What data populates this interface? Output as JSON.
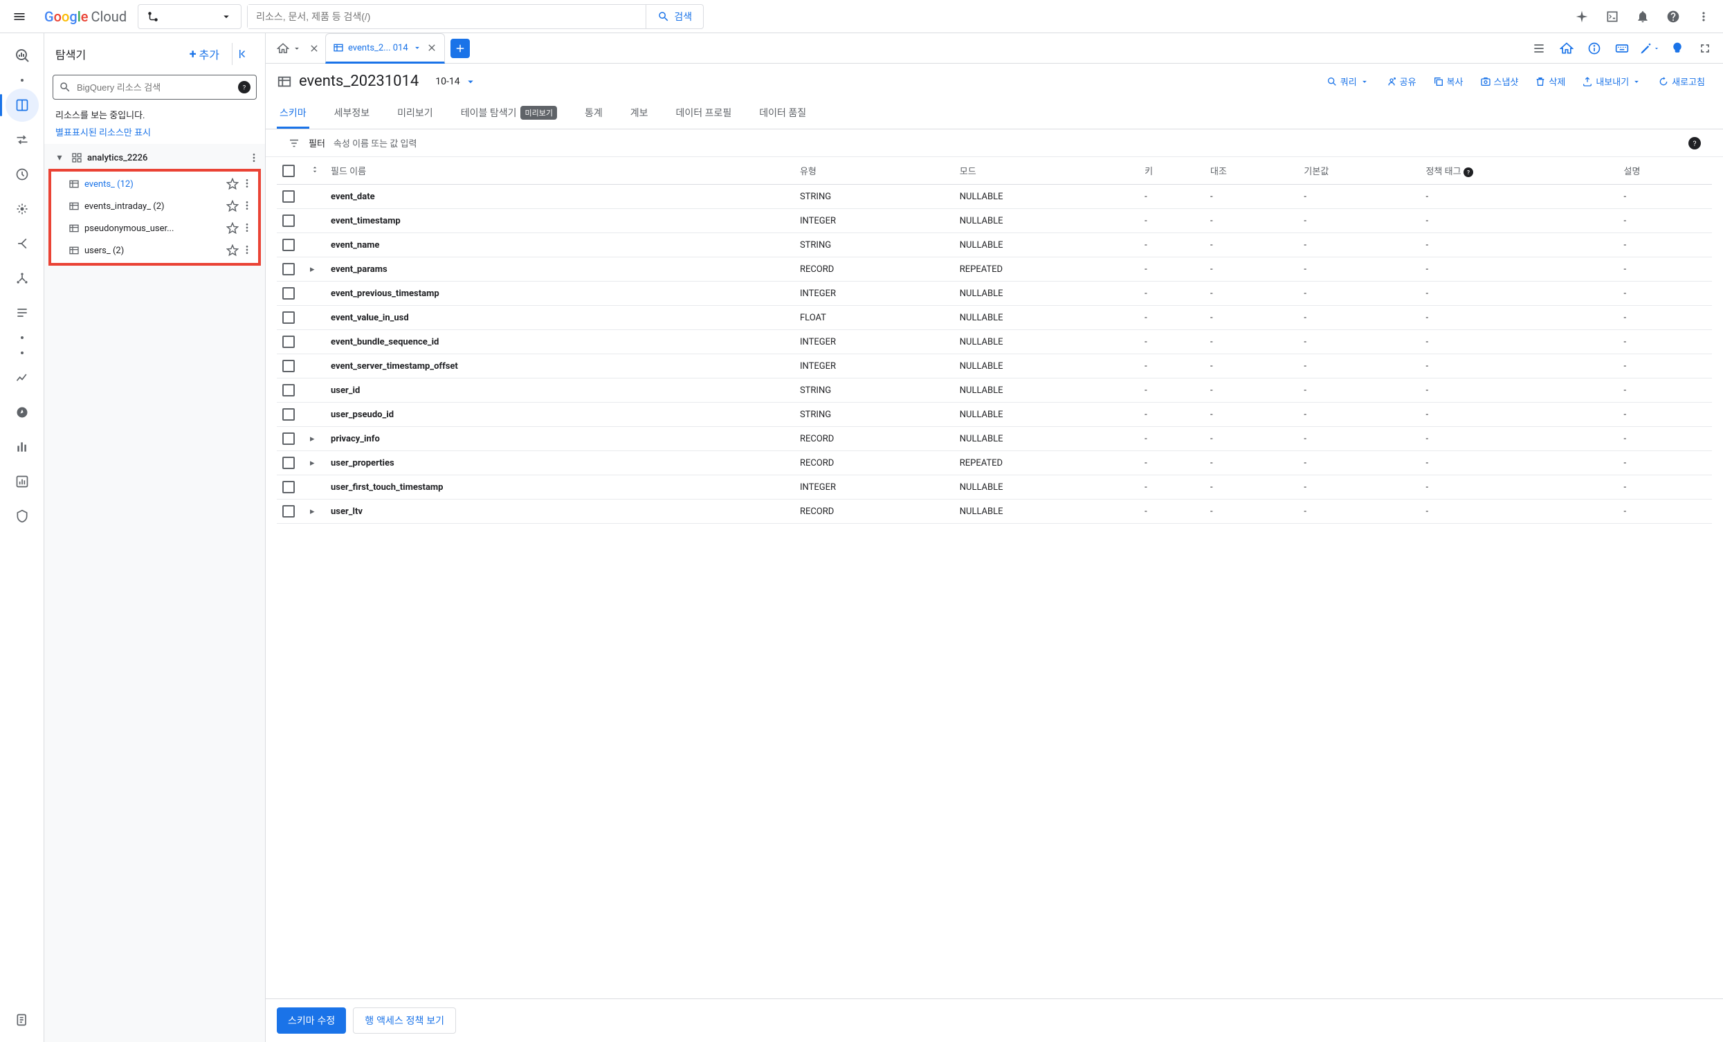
{
  "header": {
    "logo_google": "Google",
    "logo_cloud": "Cloud",
    "search_placeholder": "리소스, 문서, 제품 등 검색(/)",
    "search_button": "검색"
  },
  "explorer": {
    "title": "탐색기",
    "add": "추가",
    "search_placeholder": "BigQuery 리소스 검색",
    "loading_msg": "리소스를 보는 중입니다.",
    "starred_only": "별표표시된 리소스만 표시",
    "dataset": "analytics_2226",
    "tables": [
      {
        "label": "events_  (12)",
        "active": true
      },
      {
        "label": "events_intraday_  (2)",
        "active": false
      },
      {
        "label": "pseudonymous_user...",
        "active": false
      },
      {
        "label": "users_  (2)",
        "active": false
      }
    ]
  },
  "tabs": {
    "active_tab": "events_2... 014"
  },
  "detail": {
    "title": "events_20231014",
    "partition": "10-14",
    "actions": {
      "query": "쿼리",
      "share": "공유",
      "copy": "복사",
      "snapshot": "스냅샷",
      "delete": "삭제",
      "export": "내보내기",
      "refresh": "새로고침"
    }
  },
  "sub_tabs": {
    "schema": "스키마",
    "details": "세부정보",
    "preview": "미리보기",
    "table_explorer": "테이블 탐색기",
    "table_explorer_badge": "미리보기",
    "stats": "통계",
    "lineage": "계보",
    "data_profile": "데이터 프로필",
    "data_quality": "데이터 품질"
  },
  "filter": {
    "label": "필터",
    "placeholder": "속성 이름 또는 값 입력"
  },
  "schema_headers": {
    "field_name": "필드 이름",
    "type": "유형",
    "mode": "모드",
    "key": "키",
    "collation": "대조",
    "default": "기본값",
    "policy_tags": "정책 태그",
    "description": "설명"
  },
  "schema_rows": [
    {
      "name": "event_date",
      "type": "STRING",
      "mode": "NULLABLE",
      "expandable": false
    },
    {
      "name": "event_timestamp",
      "type": "INTEGER",
      "mode": "NULLABLE",
      "expandable": false
    },
    {
      "name": "event_name",
      "type": "STRING",
      "mode": "NULLABLE",
      "expandable": false
    },
    {
      "name": "event_params",
      "type": "RECORD",
      "mode": "REPEATED",
      "expandable": true
    },
    {
      "name": "event_previous_timestamp",
      "type": "INTEGER",
      "mode": "NULLABLE",
      "expandable": false
    },
    {
      "name": "event_value_in_usd",
      "type": "FLOAT",
      "mode": "NULLABLE",
      "expandable": false
    },
    {
      "name": "event_bundle_sequence_id",
      "type": "INTEGER",
      "mode": "NULLABLE",
      "expandable": false
    },
    {
      "name": "event_server_timestamp_offset",
      "type": "INTEGER",
      "mode": "NULLABLE",
      "expandable": false
    },
    {
      "name": "user_id",
      "type": "STRING",
      "mode": "NULLABLE",
      "expandable": false
    },
    {
      "name": "user_pseudo_id",
      "type": "STRING",
      "mode": "NULLABLE",
      "expandable": false
    },
    {
      "name": "privacy_info",
      "type": "RECORD",
      "mode": "NULLABLE",
      "expandable": true
    },
    {
      "name": "user_properties",
      "type": "RECORD",
      "mode": "REPEATED",
      "expandable": true
    },
    {
      "name": "user_first_touch_timestamp",
      "type": "INTEGER",
      "mode": "NULLABLE",
      "expandable": false
    },
    {
      "name": "user_ltv",
      "type": "RECORD",
      "mode": "NULLABLE",
      "expandable": true
    }
  ],
  "footer": {
    "edit_schema": "스키마 수정",
    "view_row_access": "행 액세스 정책 보기"
  }
}
